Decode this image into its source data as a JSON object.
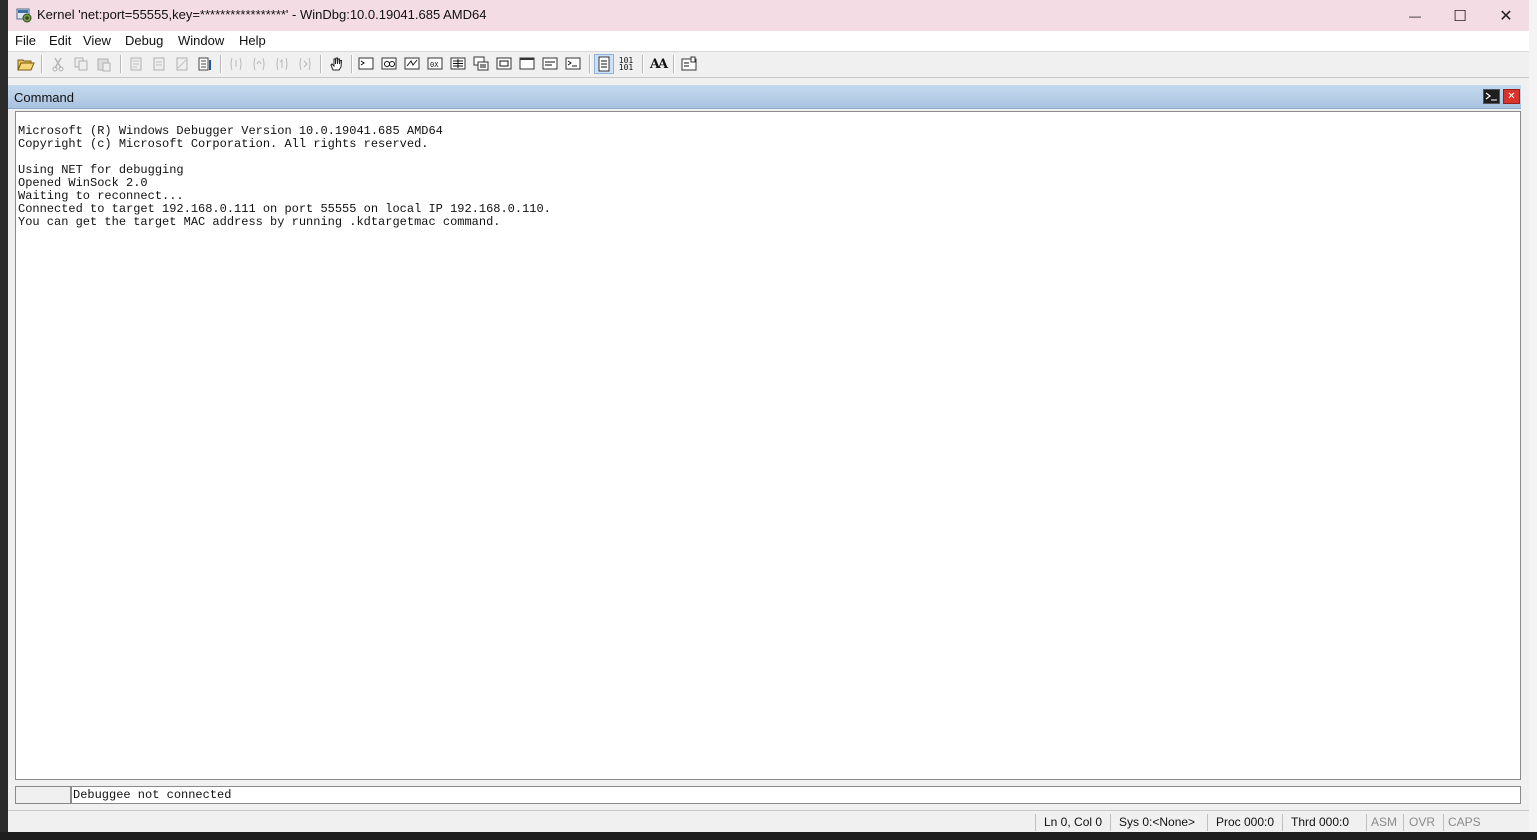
{
  "window": {
    "title": "Kernel 'net:port=55555,key=*****************' - WinDbg:10.0.19041.685 AMD64",
    "minimize_glyph": "—",
    "maximize_glyph": "☐",
    "close_glyph": "✕"
  },
  "menu": {
    "items": [
      {
        "label": "File"
      },
      {
        "label": "Edit"
      },
      {
        "label": "View"
      },
      {
        "label": "Debug"
      },
      {
        "label": "Window"
      },
      {
        "label": "Help"
      }
    ]
  },
  "toolbar": {
    "hex_label_top": "101",
    "hex_label_bottom": "101",
    "font_label": "AA"
  },
  "command_window": {
    "title": "Command",
    "output_lines": [
      "Microsoft (R) Windows Debugger Version 10.0.19041.685 AMD64",
      "Copyright (c) Microsoft Corporation. All rights reserved.",
      "",
      "Using NET for debugging",
      "Opened WinSock 2.0",
      "Waiting to reconnect...",
      "Connected to target 192.168.0.111 on port 55555 on local IP 192.168.0.110.",
      "You can get the target MAC address by running .kdtargetmac command."
    ],
    "prompt": "",
    "input_value": "Debuggee not connected"
  },
  "statusbar": {
    "position": "Ln 0, Col 0",
    "sys": "Sys 0:<None>",
    "proc": "Proc 000:0",
    "thrd": "Thrd 000:0",
    "asm": "ASM",
    "ovr": "OVR",
    "caps": "CAPS"
  },
  "colors": {
    "titlebar_bg": "#f3dce3",
    "command_header_bg": "#b7cde7",
    "close_red": "#d9342b"
  }
}
